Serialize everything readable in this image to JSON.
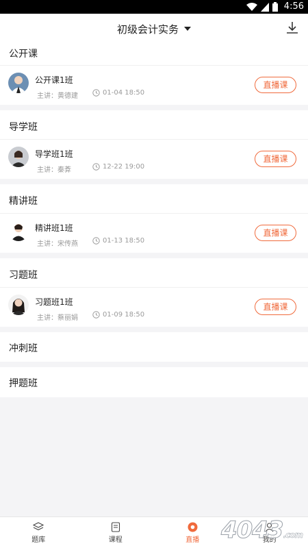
{
  "status_bar": {
    "time": "4:56"
  },
  "header": {
    "title": "初级会计实务"
  },
  "sections": [
    {
      "title": "公开课",
      "course": {
        "name": "公开课1班",
        "teacher": "主讲：黄德建",
        "time": "01-04 18:50",
        "button": "直播课"
      }
    },
    {
      "title": "导学班",
      "course": {
        "name": "导学班1班",
        "teacher": "主讲：秦葊",
        "time": "12-22 19:00",
        "button": "直播课"
      }
    },
    {
      "title": "精讲班",
      "course": {
        "name": "精讲班1班",
        "teacher": "主讲：宋传燕",
        "time": "01-13 18:50",
        "button": "直播课"
      }
    },
    {
      "title": "习题班",
      "course": {
        "name": "习题班1班",
        "teacher": "主讲：蔡丽娟",
        "time": "01-09 18:50",
        "button": "直播课"
      }
    },
    {
      "title": "冲刺班"
    },
    {
      "title": "押题班"
    }
  ],
  "bottom_nav": [
    {
      "label": "题库",
      "icon": "layers-icon"
    },
    {
      "label": "课程",
      "icon": "book-icon"
    },
    {
      "label": "直播",
      "icon": "live-icon",
      "active": true
    },
    {
      "label": "我的",
      "icon": "person-icon"
    }
  ],
  "watermark": {
    "text": "4043",
    "suffix": ".com"
  },
  "colors": {
    "accent": "#f06a3c",
    "background": "#f4f4f6"
  }
}
